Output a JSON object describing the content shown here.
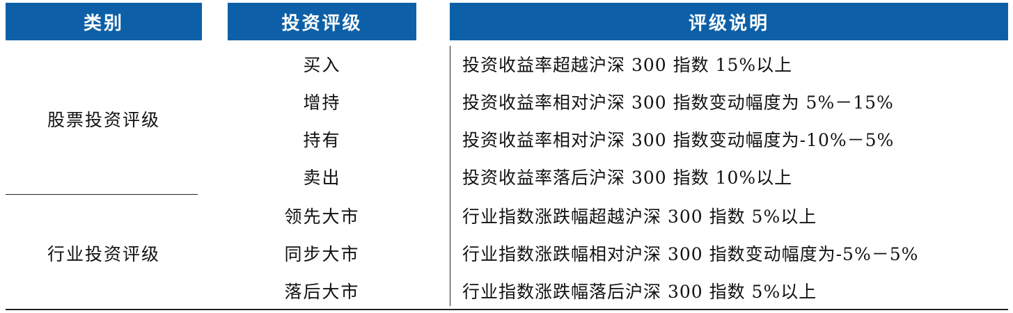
{
  "headers": [
    "类别",
    "投资评级",
    "评级说明"
  ],
  "groups": [
    {
      "category": "股票投资评级",
      "rows": [
        {
          "rating": "买入",
          "description": "投资收益率超越沪深 300 指数 15%以上"
        },
        {
          "rating": "增持",
          "description": "投资收益率相对沪深 300 指数变动幅度为 5%－15%"
        },
        {
          "rating": "持有",
          "description": "投资收益率相对沪深 300 指数变动幅度为-10%－5%"
        },
        {
          "rating": "卖出",
          "description": "投资收益率落后沪深 300 指数 10%以上"
        }
      ]
    },
    {
      "category": "行业投资评级",
      "rows": [
        {
          "rating": "领先大市",
          "description": "行业指数涨跌幅超越沪深 300 指数 5%以上"
        },
        {
          "rating": "同步大市",
          "description": "行业指数涨跌幅相对沪深 300 指数变动幅度为-5%－5%"
        },
        {
          "rating": "落后大市",
          "description": "行业指数涨跌幅落后沪深 300 指数 5%以上"
        }
      ]
    }
  ],
  "colors": {
    "header_bg": "#0d60a7",
    "header_text": "#ffffff",
    "rule": "#222222"
  }
}
